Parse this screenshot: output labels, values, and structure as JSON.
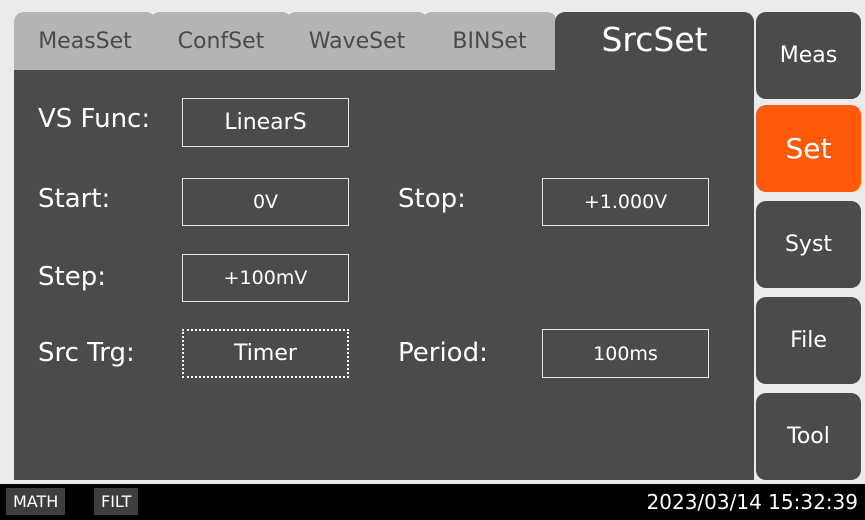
{
  "tabs": [
    {
      "label": "MeasSet",
      "active": false
    },
    {
      "label": "ConfSet",
      "active": false
    },
    {
      "label": "WaveSet",
      "active": false
    },
    {
      "label": "BINSet",
      "active": false
    },
    {
      "label": "SrcSet",
      "active": true
    }
  ],
  "form": {
    "vs_func": {
      "label": "VS Func:",
      "value": "LinearS"
    },
    "start": {
      "label": "Start:",
      "value": "0V"
    },
    "stop": {
      "label": "Stop:",
      "value": "+1.000V"
    },
    "step": {
      "label": "Step:",
      "value": "+100mV"
    },
    "src_trg": {
      "label": "Src Trg:",
      "value": "Timer"
    },
    "period": {
      "label": "Period:",
      "value": "100ms"
    }
  },
  "side_menu": [
    {
      "label": "Meas",
      "active": false
    },
    {
      "label": "Set",
      "active": true
    },
    {
      "label": "Syst",
      "active": false
    },
    {
      "label": "File",
      "active": false
    },
    {
      "label": "Tool",
      "active": false
    }
  ],
  "status": {
    "badges": [
      "MATH",
      "FILT"
    ],
    "datetime": "2023/03/14 15:32:39"
  },
  "colors": {
    "panel": "#4b4b4b",
    "tab_inactive": "#b4b4b4",
    "accent": "#ff5a0a",
    "status_bar": "#000000"
  }
}
